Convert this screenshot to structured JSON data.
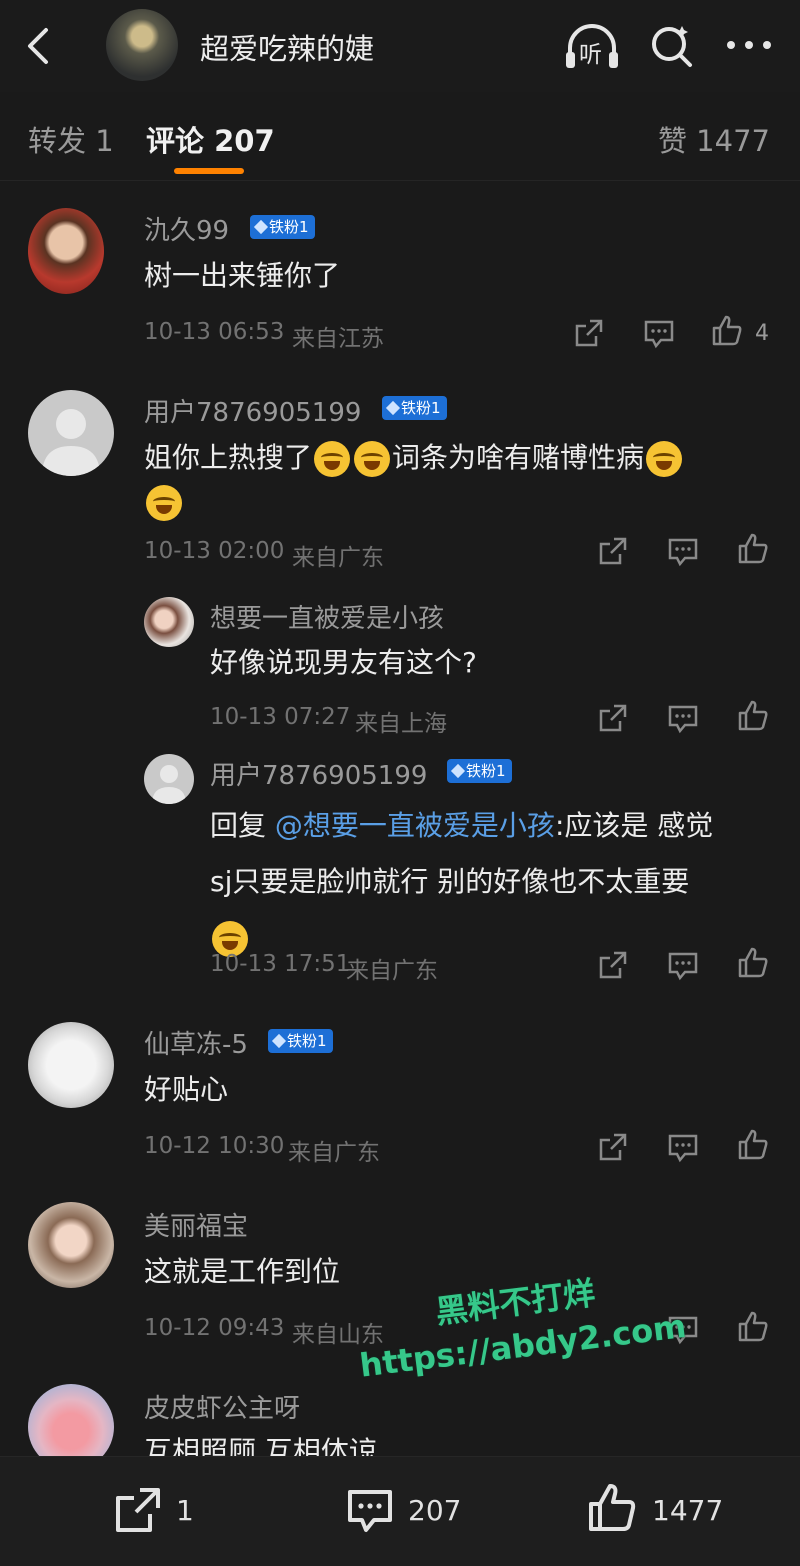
{
  "header": {
    "title": "超爱吃辣的婕",
    "listen_label": "听"
  },
  "tabs": {
    "repost": "转发 1",
    "comments": "评论 207",
    "likes": "赞 1477"
  },
  "comments": [
    {
      "user": "氿久99",
      "badge": "铁粉1",
      "text": "树一出来锤你了",
      "time": "10-13 06:53",
      "location": "来自江苏",
      "likes": "4"
    },
    {
      "user": "用户7876905199",
      "badge": "铁粉1",
      "text_a": "姐你上热搜了",
      "text_b": "词条为啥有赌博性病",
      "time": "10-13 02:00",
      "location": "来自广东",
      "replies": [
        {
          "user": "想要一直被爱是小孩",
          "text": "好像说现男友有这个?",
          "time": "10-13 07:27",
          "location": "来自上海"
        },
        {
          "user": "用户7876905199",
          "badge": "铁粉1",
          "prefix": "回复",
          "mention": "@想要一直被爱是小孩",
          "line1": ":应该是 感觉",
          "line2": "sj只要是脸帅就行 别的好像也不太重要",
          "time": "10-13 17:51",
          "location": "来自广东"
        }
      ]
    },
    {
      "user": "仙草冻-5",
      "badge": "铁粉1",
      "text": "好贴心",
      "time": "10-12 10:30",
      "location": "来自广东"
    },
    {
      "user": "美丽福宝",
      "text": "这就是工作到位",
      "time": "10-12 09:43",
      "location": "来自山东"
    },
    {
      "user": "皮皮虾公主呀",
      "text": "互相照顾  互相体谅"
    }
  ],
  "watermark": {
    "line1": "黑料不打烊",
    "line2": "https://abdy2.com"
  },
  "bottom": {
    "reposts": "1",
    "comments": "207",
    "likes": "1477"
  },
  "colors": {
    "background": "#1a1a1a",
    "accent": "#ff8200",
    "mention": "#5a9fe6",
    "badge": "#1d6fd6"
  }
}
